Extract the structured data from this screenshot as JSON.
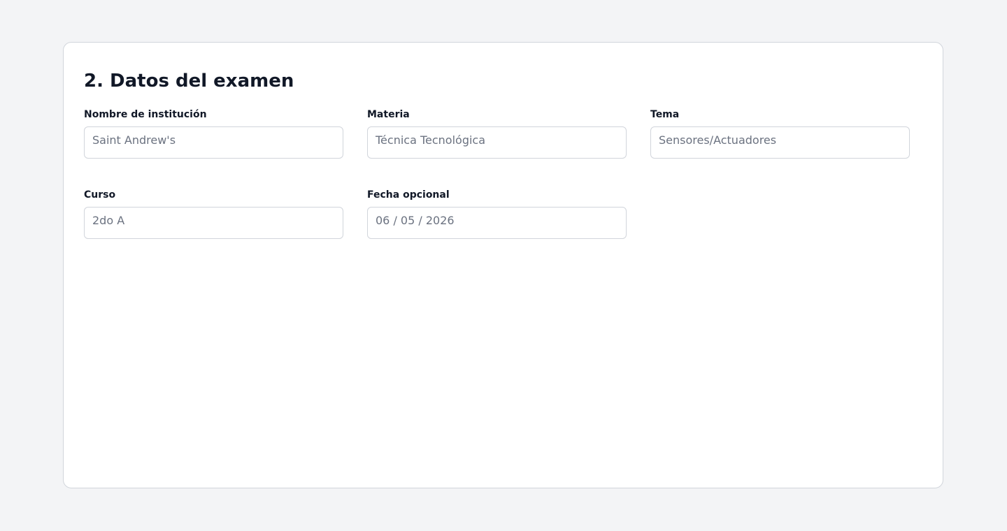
{
  "section": {
    "title": "2. Datos del examen"
  },
  "fields": {
    "institution": {
      "label": "Nombre de institución",
      "value": "Saint Andrew's"
    },
    "subject": {
      "label": "Materia",
      "value": "Técnica Tecnológica"
    },
    "topic": {
      "label": "Tema",
      "value": "Sensores/Actuadores"
    },
    "course": {
      "label": "Curso",
      "value": "2do A"
    },
    "date": {
      "label": "Fecha opcional",
      "value": "06 / 05 / 2026"
    }
  },
  "colors": {
    "page_background": "#f3f4f6",
    "card_background": "#ffffff",
    "border": "#d1d5db",
    "heading_text": "#111827",
    "input_text": "#6b7280"
  }
}
